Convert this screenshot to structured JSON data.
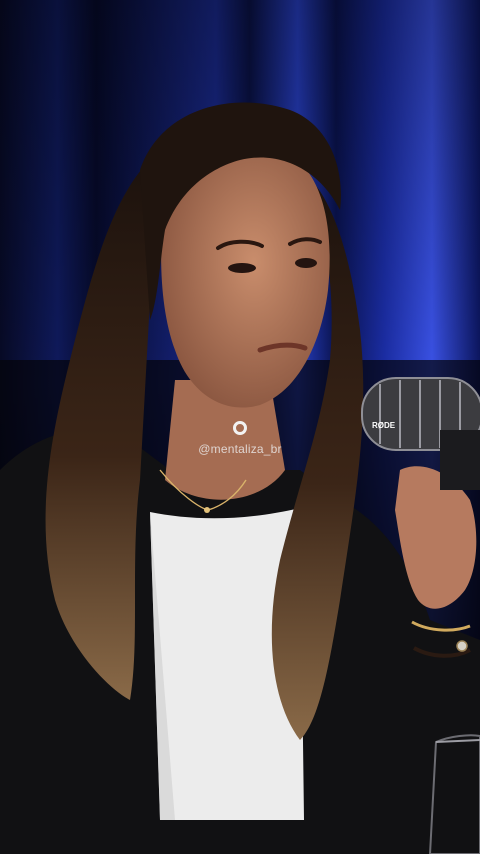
{
  "video": {
    "watermark": {
      "icon": "instagram-ring-icon",
      "handle": "@mentaliza_br"
    },
    "colors": {
      "curtain_blue": "#1d2f9a",
      "background": "#05060f",
      "jacket": "#121214",
      "shirt": "#ececec",
      "skin": "#b57a5e",
      "hair": "#3a2418"
    },
    "microphone_brand": "RØDE"
  }
}
